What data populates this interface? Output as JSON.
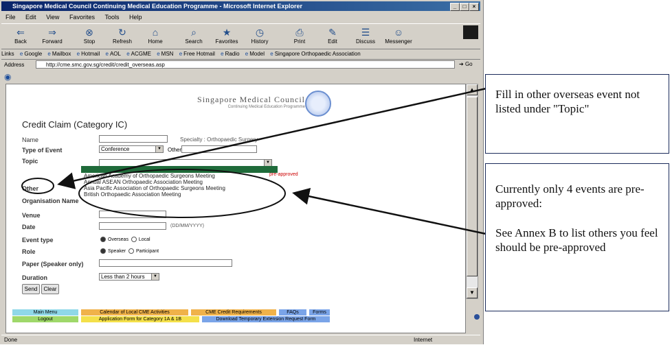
{
  "browser": {
    "title": "Singapore Medical Council Continuing Medical Education Programme - Microsoft Internet Explorer",
    "menu": [
      "File",
      "Edit",
      "View",
      "Favorites",
      "Tools",
      "Help"
    ],
    "toolbar": [
      "Back",
      "Forward",
      "Stop",
      "Refresh",
      "Home",
      "Search",
      "Favorites",
      "History",
      "Print",
      "Edit",
      "Discuss",
      "Messenger"
    ],
    "links_label": "Links",
    "links": [
      "Google",
      "Mailbox",
      "Hotmail",
      "AOL",
      "ACGME",
      "MSN",
      "Free Hotmail",
      "Radio",
      "Model",
      "Singapore Orthopaedic Association"
    ],
    "address_label": "Address",
    "address_url": "http://cme.smc.gov.sg/credit/credit_overseas.asp",
    "go_label": "Go",
    "status_left": "Done",
    "status_right": "Internet"
  },
  "page": {
    "logo_title": "Singapore Medical Council",
    "logo_subtitle": "Continuing Medical Education Programme",
    "form_title": "Credit Claim (Category IC)",
    "labels": {
      "name": "Name",
      "specialty": "Specialty : Orthopaedic Surgery",
      "type_of_event": "Type of Event",
      "topic": "Topic",
      "other": "Other",
      "organisation": "Organisation Name",
      "venue": "Venue",
      "date": "Date",
      "date_hint": "(DD/MM/YYYY)",
      "event_type": "Event type",
      "role": "Role",
      "paper": "Paper (Speaker only)",
      "duration": "Duration"
    },
    "type_of_event_value": "Conference",
    "other_inline_label": "Other",
    "event_type_options": [
      "Overseas",
      "Local"
    ],
    "role_options": [
      "Speaker",
      "Participant"
    ],
    "duration_value": "Less than 2 hours",
    "topic_options": [
      "American Academy of Orthopaedic Surgeons Meeting",
      "Annual ASEAN Orthopaedic Association Meeting",
      "Asia Pacific Association of Orthopaedic Surgeons Meeting",
      "British Orthopaedic Association Meeting"
    ],
    "red_note": "pre-approved",
    "buttons": {
      "submit": "Send",
      "clear": "Clear"
    }
  },
  "nav": {
    "row1": [
      "Main Menu",
      "Calendar of Local CME Activities",
      "CME Credit Requirements",
      "FAQs",
      "Forms"
    ],
    "row2": [
      "Logout",
      "Application Form for Category 1A & 1B",
      "Download Temporary Extension Request Form"
    ],
    "colors": {
      "cyan": "#8fd8e8",
      "orange": "#f0b24a",
      "blue": "#7aa4e8",
      "green": "#9fd86a",
      "yellow": "#f4e04a"
    }
  },
  "callouts": {
    "top": "Fill in other overseas event not listed under \"Topic\"",
    "bottom_line1": "Currently only 4 events are pre-approved:",
    "bottom_line2": "See Annex B to list others you feel should be pre-approved"
  }
}
